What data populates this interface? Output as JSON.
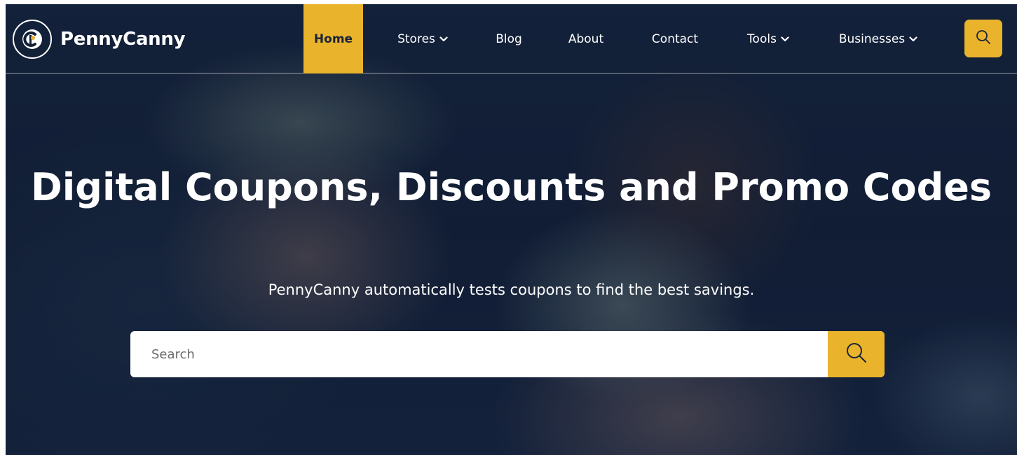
{
  "brand": {
    "name": "PennyCanny",
    "logo_icon": "penny-coin-logo-icon"
  },
  "nav": {
    "items": [
      {
        "label": "Home",
        "active": true,
        "has_dropdown": false
      },
      {
        "label": "Stores",
        "active": false,
        "has_dropdown": true
      },
      {
        "label": "Blog",
        "active": false,
        "has_dropdown": false
      },
      {
        "label": "About",
        "active": false,
        "has_dropdown": false
      },
      {
        "label": "Contact",
        "active": false,
        "has_dropdown": false
      },
      {
        "label": "Tools",
        "active": false,
        "has_dropdown": true
      },
      {
        "label": "Businesses",
        "active": false,
        "has_dropdown": true
      }
    ],
    "search_icon": "search-icon"
  },
  "hero": {
    "title": "Digital Coupons, Discounts and Promo Codes",
    "subtitle": "PennyCanny automatically tests coupons to find the best savings.",
    "search": {
      "placeholder": "Search",
      "value": "",
      "button_icon": "search-icon"
    }
  },
  "colors": {
    "accent": "#e9b32c",
    "nav_text": "#ffffff",
    "active_text": "#1b2437",
    "hero_overlay": "#0a162c"
  }
}
